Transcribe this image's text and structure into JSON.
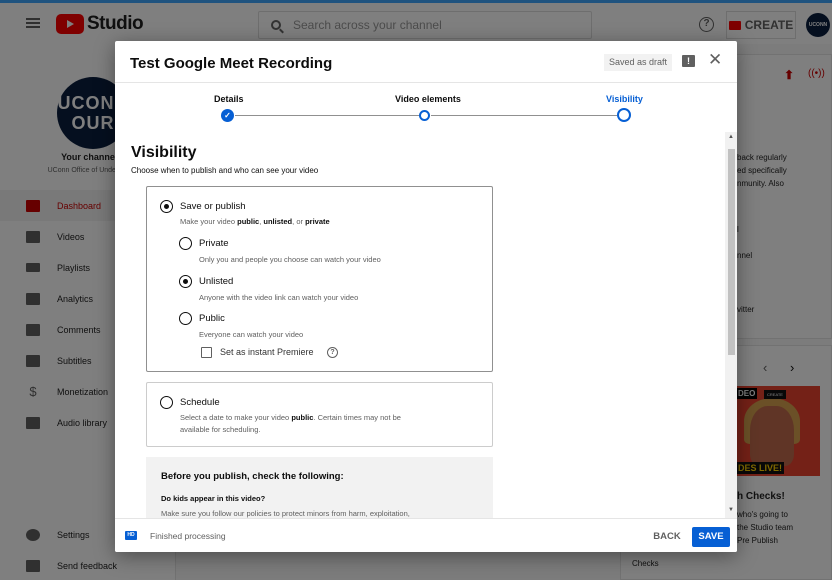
{
  "app": {
    "logo_text": "Studio",
    "search_placeholder": "Search across your channel",
    "create_label": "CREATE",
    "avatar_text": "UCONN"
  },
  "sidebar": {
    "avatar_text": "UCONN OUR",
    "channel_label": "Your channe",
    "channel_name": "UConn Office of Undergra",
    "items": [
      {
        "label": "Dashboard",
        "icon": "dashboard-icon"
      },
      {
        "label": "Videos",
        "icon": "videos-icon"
      },
      {
        "label": "Playlists",
        "icon": "playlists-icon"
      },
      {
        "label": "Analytics",
        "icon": "analytics-icon"
      },
      {
        "label": "Comments",
        "icon": "comments-icon"
      },
      {
        "label": "Subtitles",
        "icon": "subtitles-icon"
      },
      {
        "label": "Monetization",
        "icon": "dollar-icon"
      },
      {
        "label": "Audio library",
        "icon": "audio-library-icon"
      }
    ],
    "bottom_items": [
      {
        "label": "Settings",
        "icon": "gear-icon"
      },
      {
        "label": "Send feedback",
        "icon": "feedback-icon"
      }
    ]
  },
  "right_panel": {
    "text_lines": [
      "back regularly",
      "ed specifically",
      "nmunity. Also",
      "l",
      "nnel",
      "vitter"
    ],
    "card_title": "h Checks!",
    "card_lines": [
      "who's going to",
      "the Studio team",
      "Pre Publish",
      "Checks"
    ],
    "thumb_tag1": "DEO",
    "thumb_tag2": "CREATE",
    "thumb_tag3": "DES LIVE!"
  },
  "dialog": {
    "title": "Test Google Meet Recording",
    "draft_status": "Saved as draft",
    "steps": [
      {
        "label": "Details",
        "state": "done"
      },
      {
        "label": "Video elements",
        "state": "pending"
      },
      {
        "label": "Visibility",
        "state": "current"
      }
    ],
    "heading": "Visibility",
    "subheading": "Choose when to publish and who can see your video",
    "save_or_publish": {
      "label": "Save or publish",
      "desc_prefix": "Make your video ",
      "desc_public": "public",
      "desc_sep1": ", ",
      "desc_unlisted": "unlisted",
      "desc_sep2": ", or ",
      "desc_private": "private",
      "selected": true
    },
    "options": [
      {
        "label": "Private",
        "desc": "Only you and people you choose can watch your video",
        "selected": false
      },
      {
        "label": "Unlisted",
        "desc": "Anyone with the video link can watch your video",
        "selected": true
      },
      {
        "label": "Public",
        "desc": "Everyone can watch your video",
        "selected": false
      }
    ],
    "premiere_label": "Set as instant Premiere",
    "schedule": {
      "label": "Schedule",
      "desc_prefix": "Select a date to make your video ",
      "desc_bold": "public",
      "desc_suffix": ". Certain times may not be",
      "desc_line2": "available for scheduling."
    },
    "checklist": {
      "heading": "Before you publish, check the following:",
      "question": "Do kids appear in this video?",
      "desc": "Make sure you follow our policies to protect minors from harm, exploitation,"
    },
    "footer": {
      "badge": "HD",
      "status": "Finished processing",
      "back_label": "BACK",
      "save_label": "SAVE"
    }
  },
  "colors": {
    "accent_blue": "#065fd4",
    "youtube_red": "#ff0000",
    "active_nav_red": "#cc0000"
  }
}
